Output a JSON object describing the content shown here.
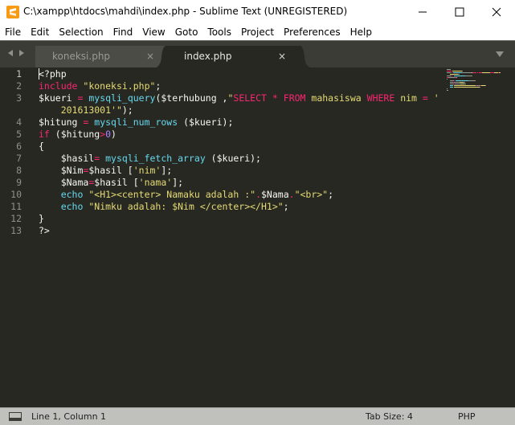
{
  "window": {
    "title": "C:\\xampp\\htdocs\\mahdi\\index.php - Sublime Text (UNREGISTERED)",
    "min_glyph": "—",
    "close_glyph": "✕"
  },
  "menu": [
    "File",
    "Edit",
    "Selection",
    "Find",
    "View",
    "Goto",
    "Tools",
    "Project",
    "Preferences",
    "Help"
  ],
  "tabs": [
    {
      "label": "koneksi.php",
      "close": "×",
      "active": false
    },
    {
      "label": "index.php",
      "close": "×",
      "active": true
    }
  ],
  "line_numbers": [
    "1",
    "2",
    "3",
    "",
    "4",
    "5",
    "6",
    "7",
    "8",
    "9",
    "10",
    "11",
    "12",
    "13"
  ],
  "code": [
    [
      [
        "t-plain",
        "<?php"
      ]
    ],
    [
      [
        "t-kw",
        "include"
      ],
      [
        "t-plain",
        " "
      ],
      [
        "t-str",
        "\"koneksi.php\""
      ],
      [
        "t-plain",
        ";"
      ]
    ],
    [
      [
        "t-var",
        "$kueri"
      ],
      [
        "t-plain",
        " "
      ],
      [
        "t-kw",
        "="
      ],
      [
        "t-plain",
        " "
      ],
      [
        "t-fn",
        "mysqli_query"
      ],
      [
        "t-plain",
        "($terhubung ,"
      ],
      [
        "t-str",
        "\""
      ],
      [
        "t-sql",
        "SELECT"
      ],
      [
        "t-str",
        " "
      ],
      [
        "t-kw",
        "*"
      ],
      [
        "t-str",
        " "
      ],
      [
        "t-sql",
        "FROM"
      ],
      [
        "t-str",
        " mahasiswa "
      ],
      [
        "t-sql",
        "WHERE"
      ],
      [
        "t-str",
        " nim "
      ],
      [
        "t-kw",
        "="
      ],
      [
        "t-str",
        " '"
      ]
    ],
    [
      [
        "t-plain",
        "    "
      ],
      [
        "t-str",
        "201613001'\""
      ],
      [
        "t-plain",
        ");"
      ]
    ],
    [
      [
        "t-var",
        "$hitung"
      ],
      [
        "t-plain",
        " "
      ],
      [
        "t-kw",
        "="
      ],
      [
        "t-plain",
        " "
      ],
      [
        "t-fn",
        "mysqli_num_rows"
      ],
      [
        "t-plain",
        " ($kueri);"
      ]
    ],
    [
      [
        "t-kw",
        "if"
      ],
      [
        "t-plain",
        " ($hitung"
      ],
      [
        "t-kw",
        ">"
      ],
      [
        "t-num",
        "0"
      ],
      [
        "t-plain",
        ")"
      ]
    ],
    [
      [
        "t-plain",
        "{"
      ]
    ],
    [
      [
        "t-plain",
        "    "
      ],
      [
        "t-var",
        "$hasil"
      ],
      [
        "t-kw",
        "="
      ],
      [
        "t-plain",
        " "
      ],
      [
        "t-fn",
        "mysqli_fetch_array"
      ],
      [
        "t-plain",
        " ($kueri);"
      ]
    ],
    [
      [
        "t-plain",
        "    "
      ],
      [
        "t-var",
        "$Nim"
      ],
      [
        "t-kw",
        "="
      ],
      [
        "t-plain",
        "$hasil ["
      ],
      [
        "t-str",
        "'nim'"
      ],
      [
        "t-plain",
        "];"
      ]
    ],
    [
      [
        "t-plain",
        "    "
      ],
      [
        "t-var",
        "$Nama"
      ],
      [
        "t-kw",
        "="
      ],
      [
        "t-plain",
        "$hasil ["
      ],
      [
        "t-str",
        "'nama'"
      ],
      [
        "t-plain",
        "];"
      ]
    ],
    [
      [
        "t-plain",
        "    "
      ],
      [
        "t-fn",
        "echo"
      ],
      [
        "t-plain",
        " "
      ],
      [
        "t-str",
        "\"<H1><center> Namaku adalah :\""
      ],
      [
        "t-kw",
        "."
      ],
      [
        "t-plain",
        "$Nama"
      ],
      [
        "t-kw",
        "."
      ],
      [
        "t-str",
        "\"<br>\""
      ],
      [
        "t-plain",
        ";"
      ]
    ],
    [
      [
        "t-plain",
        "    "
      ],
      [
        "t-fn",
        "echo"
      ],
      [
        "t-plain",
        " "
      ],
      [
        "t-str",
        "\"Nimku adalah: $Nim </center></H1>\""
      ],
      [
        "t-plain",
        ";"
      ]
    ],
    [
      [
        "t-plain",
        "}"
      ]
    ],
    [
      [
        "t-plain",
        "?>"
      ]
    ]
  ],
  "status": {
    "position": "Line 1, Column 1",
    "tab_size": "Tab Size: 4",
    "syntax": "PHP"
  },
  "colors": {
    "editor_bg": "#272822",
    "keyword": "#f92672",
    "function": "#66d9ef",
    "string": "#e6db74",
    "number": "#ae81ff",
    "text": "#f8f8f2"
  },
  "icons": [
    "sublime-text-icon",
    "minimize-icon",
    "maximize-icon",
    "close-icon",
    "arrow-left-icon",
    "arrow-right-icon",
    "tab-list-dropdown-icon",
    "panel-toggle-icon"
  ]
}
